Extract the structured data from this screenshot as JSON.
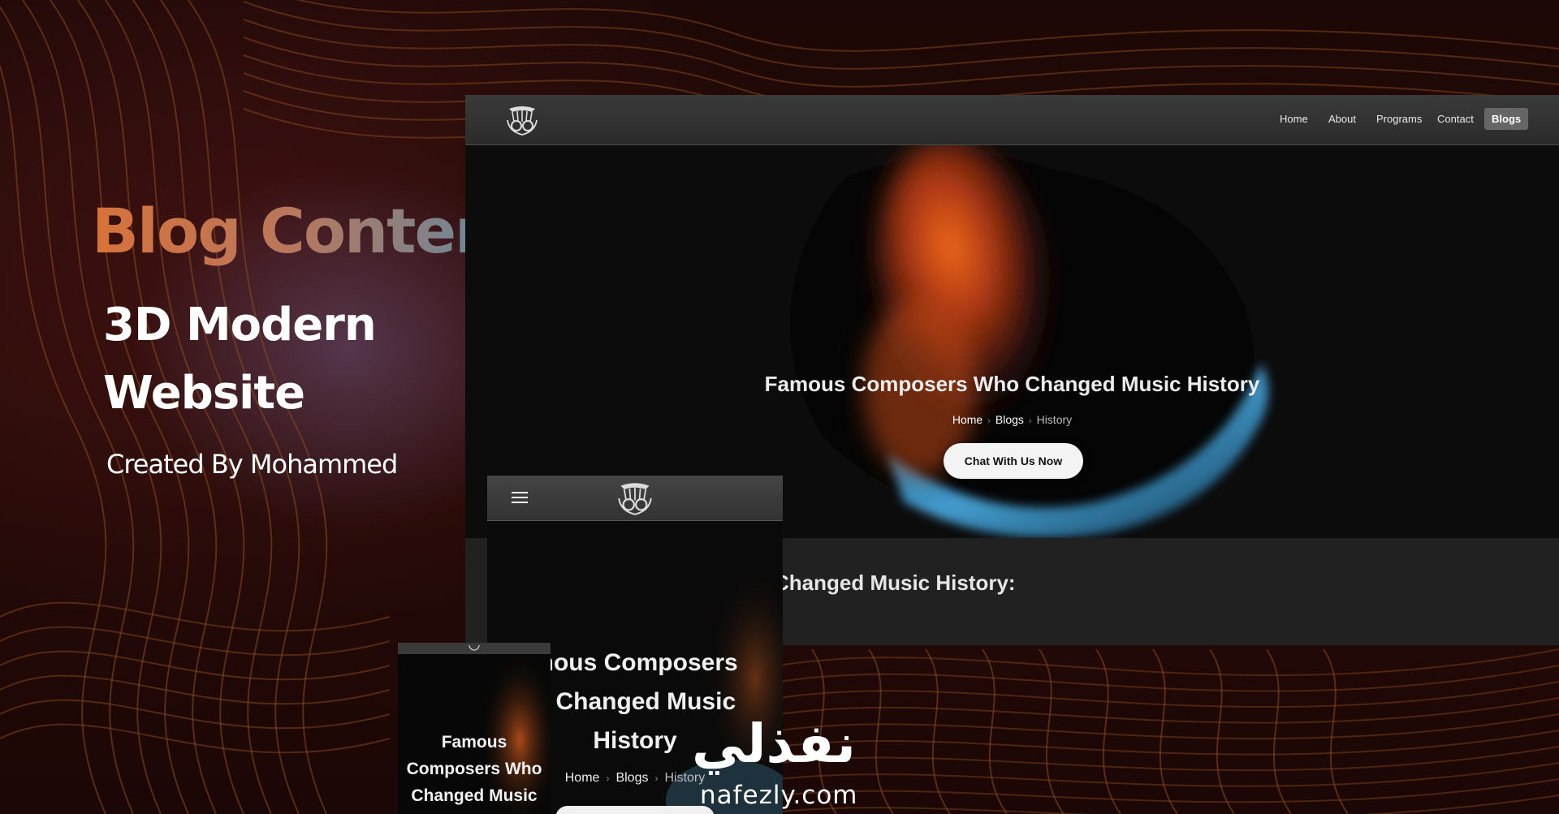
{
  "promo": {
    "title": "Blog Content",
    "subtitle_line1": "3D Modern",
    "subtitle_line2": "Website",
    "credit": "Created By Mohammed"
  },
  "desktop": {
    "nav": [
      {
        "label": "Home"
      },
      {
        "label": "About"
      },
      {
        "label": "Programs"
      },
      {
        "label": "Contact"
      },
      {
        "label": "Blogs",
        "active": true
      }
    ],
    "hero_title": "Famous Composers Who Changed Music History",
    "breadcrumb": [
      "Home",
      "Blogs",
      "History"
    ],
    "cta_label": "Chat With Us Now",
    "section_heading": "Changed Music History:"
  },
  "tablet": {
    "menu_icon": "hamburger-icon",
    "title_lines": [
      "mous Composers",
      "o Changed Music",
      "History"
    ],
    "breadcrumb": [
      "Home",
      "Blogs",
      "History"
    ]
  },
  "phone": {
    "title_lines": [
      "Famous",
      "Composers Who",
      "Changed Music"
    ]
  },
  "watermark": {
    "arabic": "نفذلي",
    "latin": "nafezly.com"
  },
  "colors": {
    "title_gradient_start": "#d7723b",
    "title_gradient_end": "#5d8aa6",
    "contour_line": "#8a4a1c",
    "blob_orange": "#e8541a",
    "blob_blue": "#3a8fc4"
  },
  "icons": {
    "logo": "lyre-crest-logo",
    "menu": "hamburger-icon",
    "breadcrumb_separator": "chevron-right-icon"
  }
}
